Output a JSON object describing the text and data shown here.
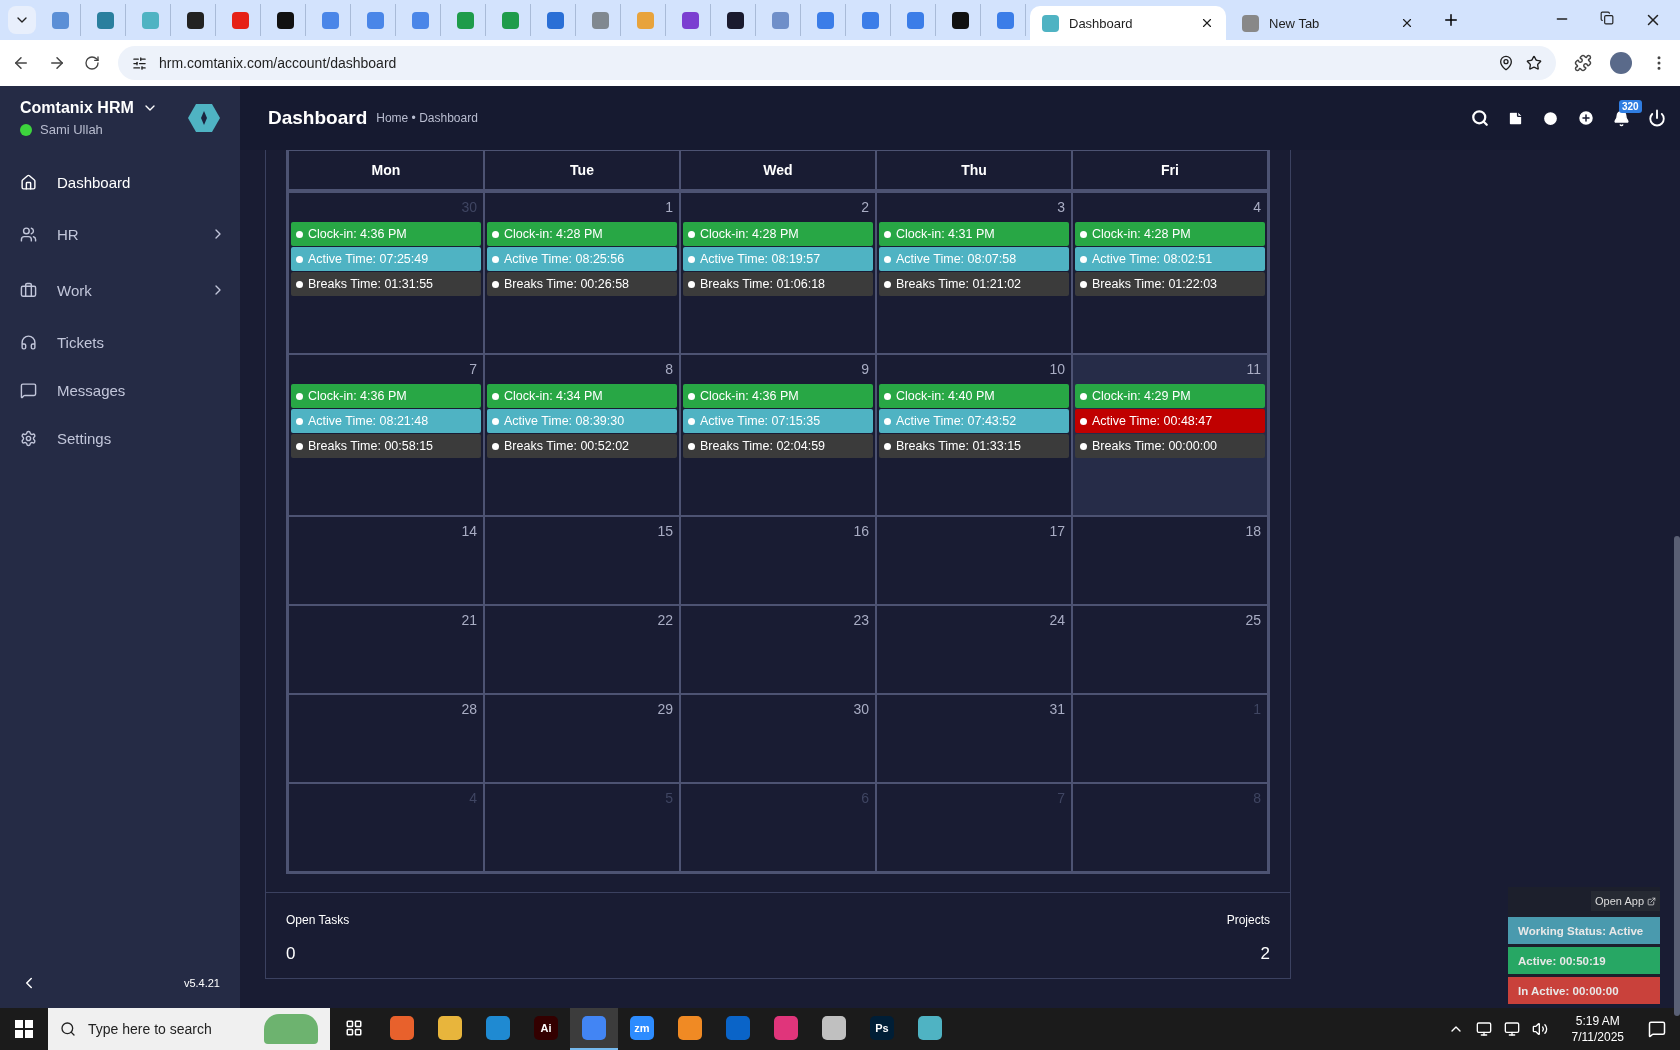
{
  "browser": {
    "pinned_tabs": [
      {
        "color": "#5b8fd6"
      },
      {
        "color": "#2a7f9e"
      },
      {
        "color": "#4fb3c3"
      },
      {
        "color": "#222222"
      },
      {
        "color": "#e62117"
      },
      {
        "color": "#111111"
      },
      {
        "color": "#4a86e8"
      },
      {
        "color": "#4a86e8"
      },
      {
        "color": "#4a86e8"
      },
      {
        "color": "#1e9c4b"
      },
      {
        "color": "#1e9c4b"
      },
      {
        "color": "#2a6fd6"
      },
      {
        "color": "#808890"
      },
      {
        "color": "#e8a33c"
      },
      {
        "color": "#7b3fd1"
      },
      {
        "color": "#1a1a2e"
      },
      {
        "color": "#6f8fc9"
      },
      {
        "color": "#3b7de8"
      },
      {
        "color": "#3b7de8"
      },
      {
        "color": "#3b7de8"
      },
      {
        "color": "#111111"
      },
      {
        "color": "#3b7de8"
      }
    ],
    "tabs": [
      {
        "title": "Dashboard",
        "selected": true
      },
      {
        "title": "New Tab",
        "selected": false
      }
    ],
    "url": "hrm.comtanix.com/account/dashboard"
  },
  "sidebar": {
    "brand": "Comtanix HRM",
    "user": "Sami Ullah",
    "online": true,
    "items": [
      {
        "label": "Dashboard",
        "selected": true,
        "expandable": false
      },
      {
        "label": "HR",
        "selected": false,
        "expandable": true
      },
      {
        "label": "Work",
        "selected": false,
        "expandable": true
      },
      {
        "label": "Tickets",
        "selected": false,
        "expandable": false
      },
      {
        "label": "Messages",
        "selected": false,
        "expandable": false
      },
      {
        "label": "Settings",
        "selected": false,
        "expandable": false
      }
    ],
    "version": "v5.4.21"
  },
  "header": {
    "title": "Dashboard",
    "breadcrumb": "Home • Dashboard",
    "notifications": "320"
  },
  "calendar": {
    "days": [
      "Mon",
      "Tue",
      "Wed",
      "Thu",
      "Fri"
    ],
    "weeks": [
      [
        {
          "date": "30",
          "muted": true,
          "today": false,
          "events": [
            {
              "text": "Clock-in: 4:36 PM",
              "color": "#28a745"
            },
            {
              "text": "Active Time: 07:25:49",
              "color": "#4fb3c3"
            },
            {
              "text": "Breaks Time: 01:31:55",
              "color": "#3b3b3b"
            }
          ]
        },
        {
          "date": "1",
          "muted": false,
          "today": false,
          "events": [
            {
              "text": "Clock-in: 4:28 PM",
              "color": "#28a745"
            },
            {
              "text": "Active Time: 08:25:56",
              "color": "#4fb3c3"
            },
            {
              "text": "Breaks Time: 00:26:58",
              "color": "#3b3b3b"
            }
          ]
        },
        {
          "date": "2",
          "muted": false,
          "today": false,
          "events": [
            {
              "text": "Clock-in: 4:28 PM",
              "color": "#28a745"
            },
            {
              "text": "Active Time: 08:19:57",
              "color": "#4fb3c3"
            },
            {
              "text": "Breaks Time: 01:06:18",
              "color": "#3b3b3b"
            }
          ]
        },
        {
          "date": "3",
          "muted": false,
          "today": false,
          "events": [
            {
              "text": "Clock-in: 4:31 PM",
              "color": "#28a745"
            },
            {
              "text": "Active Time: 08:07:58",
              "color": "#4fb3c3"
            },
            {
              "text": "Breaks Time: 01:21:02",
              "color": "#3b3b3b"
            }
          ]
        },
        {
          "date": "4",
          "muted": false,
          "today": false,
          "events": [
            {
              "text": "Clock-in: 4:28 PM",
              "color": "#28a745"
            },
            {
              "text": "Active Time: 08:02:51",
              "color": "#4fb3c3"
            },
            {
              "text": "Breaks Time: 01:22:03",
              "color": "#3b3b3b"
            }
          ]
        }
      ],
      [
        {
          "date": "7",
          "muted": false,
          "today": false,
          "events": [
            {
              "text": "Clock-in: 4:36 PM",
              "color": "#28a745"
            },
            {
              "text": "Active Time: 08:21:48",
              "color": "#4fb3c3"
            },
            {
              "text": "Breaks Time: 00:58:15",
              "color": "#3b3b3b"
            }
          ]
        },
        {
          "date": "8",
          "muted": false,
          "today": false,
          "events": [
            {
              "text": "Clock-in: 4:34 PM",
              "color": "#28a745"
            },
            {
              "text": "Active Time: 08:39:30",
              "color": "#4fb3c3"
            },
            {
              "text": "Breaks Time: 00:52:02",
              "color": "#3b3b3b"
            }
          ]
        },
        {
          "date": "9",
          "muted": false,
          "today": false,
          "events": [
            {
              "text": "Clock-in: 4:36 PM",
              "color": "#28a745"
            },
            {
              "text": "Active Time: 07:15:35",
              "color": "#4fb3c3"
            },
            {
              "text": "Breaks Time: 02:04:59",
              "color": "#3b3b3b"
            }
          ]
        },
        {
          "date": "10",
          "muted": false,
          "today": false,
          "events": [
            {
              "text": "Clock-in: 4:40 PM",
              "color": "#28a745"
            },
            {
              "text": "Active Time: 07:43:52",
              "color": "#4fb3c3"
            },
            {
              "text": "Breaks Time: 01:33:15",
              "color": "#3b3b3b"
            }
          ]
        },
        {
          "date": "11",
          "muted": false,
          "today": true,
          "events": [
            {
              "text": "Clock-in: 4:29 PM",
              "color": "#28a745"
            },
            {
              "text": "Active Time: 00:48:47",
              "color": "#c00000"
            },
            {
              "text": "Breaks Time: 00:00:00",
              "color": "#3b3b3b"
            }
          ]
        }
      ],
      [
        {
          "date": "14",
          "muted": false,
          "today": false
        },
        {
          "date": "15",
          "muted": false,
          "today": false
        },
        {
          "date": "16",
          "muted": false,
          "today": false
        },
        {
          "date": "17",
          "muted": false,
          "today": false
        },
        {
          "date": "18",
          "muted": false,
          "today": false
        }
      ],
      [
        {
          "date": "21",
          "muted": false,
          "today": false
        },
        {
          "date": "22",
          "muted": false,
          "today": false
        },
        {
          "date": "23",
          "muted": false,
          "today": false
        },
        {
          "date": "24",
          "muted": false,
          "today": false
        },
        {
          "date": "25",
          "muted": false,
          "today": false
        }
      ],
      [
        {
          "date": "28",
          "muted": false,
          "today": false
        },
        {
          "date": "29",
          "muted": false,
          "today": false
        },
        {
          "date": "30",
          "muted": false,
          "today": false
        },
        {
          "date": "31",
          "muted": false,
          "today": false
        },
        {
          "date": "1",
          "muted": true,
          "today": false
        }
      ],
      [
        {
          "date": "4",
          "muted": true,
          "today": false
        },
        {
          "date": "5",
          "muted": true,
          "today": false
        },
        {
          "date": "6",
          "muted": true,
          "today": false
        },
        {
          "date": "7",
          "muted": true,
          "today": false
        },
        {
          "date": "8",
          "muted": true,
          "today": false
        }
      ]
    ]
  },
  "stats": [
    {
      "label": "Open Tasks",
      "value": "0"
    },
    {
      "label": "Projects",
      "value": "2"
    }
  ],
  "widget": {
    "open_app": "Open App",
    "statuses": [
      {
        "text": "Working Status: Active",
        "color": "#4a9aae"
      },
      {
        "text": "Active: 00:50:19",
        "color": "#27a764"
      },
      {
        "text": "In Active: 00:00:00",
        "color": "#c9413b"
      }
    ]
  },
  "taskbar": {
    "search_placeholder": "Type here to search",
    "apps": [
      {
        "color": "#e8612c",
        "selected": false
      },
      {
        "color": "#e8b53c",
        "selected": false
      },
      {
        "color": "#1f8ad2",
        "selected": false
      },
      {
        "label": "Ai",
        "color": "#330000",
        "selected": false
      },
      {
        "color": "#4285f4",
        "selected": true
      },
      {
        "label": "zm",
        "color": "#2d8cff",
        "selected": false
      },
      {
        "color": "#f08a24",
        "selected": false
      },
      {
        "color": "#0a64c8",
        "selected": false
      },
      {
        "color": "#e0357b",
        "selected": false
      },
      {
        "color": "#c0c0c0",
        "selected": false
      },
      {
        "label": "Ps",
        "color": "#001e36",
        "selected": false
      },
      {
        "color": "#4fb3c3",
        "selected": false
      }
    ],
    "time": "5:19 AM",
    "date": "7/11/2025"
  }
}
